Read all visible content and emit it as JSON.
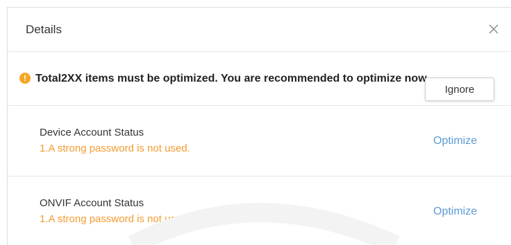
{
  "dialog": {
    "title": "Details",
    "close_icon": "close-icon"
  },
  "notice": {
    "icon": "warning-icon",
    "icon_glyph": "!",
    "text": "Total2XX items must be optimized. You are recommended to optimize now.",
    "ignore_label": "Ignore"
  },
  "items": [
    {
      "title": "Device Account Status",
      "description": "1.A strong password is not used.",
      "action_label": "Optimize"
    },
    {
      "title": "ONVIF Account Status",
      "description": "1.A strong password is not used.",
      "action_label": "Optimize"
    }
  ],
  "colors": {
    "warning": "#f5a623",
    "description": "#f39c2f",
    "link": "#5b9bd5"
  }
}
